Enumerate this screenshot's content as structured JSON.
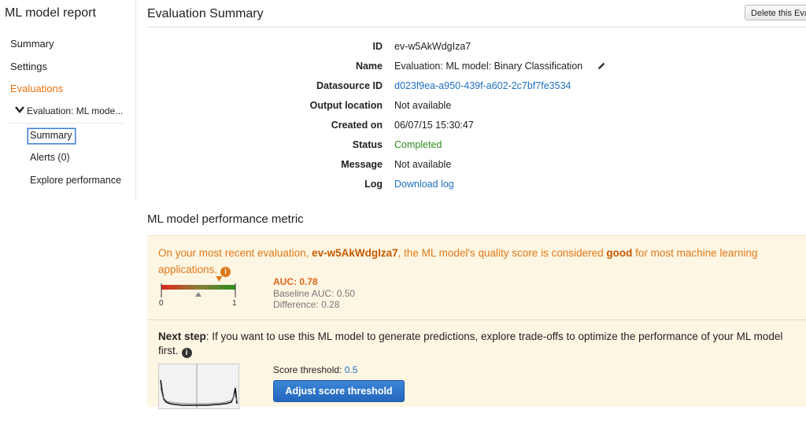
{
  "sidebar": {
    "title": "ML model report",
    "items": [
      {
        "label": "Summary"
      },
      {
        "label": "Settings"
      },
      {
        "label": "Evaluations"
      }
    ],
    "sub_title": "Evaluation: ML mode...",
    "sub_items": [
      {
        "label": "Summary"
      },
      {
        "label": "Alerts (0)"
      },
      {
        "label": "Explore performance"
      }
    ]
  },
  "header": {
    "title": "Evaluation Summary",
    "delete_button": "Delete this Evaluation"
  },
  "details": {
    "id_label": "ID",
    "id_value": "ev-w5AkWdgIza7",
    "name_label": "Name",
    "name_value": "Evaluation: ML model: Binary Classification",
    "datasource_label": "Datasource ID",
    "datasource_value": "d023f9ea-a950-439f-a602-2c7bf7fe3534",
    "output_label": "Output location",
    "output_value": "Not available",
    "created_label": "Created on",
    "created_value": "06/07/15 15:30:47",
    "status_label": "Status",
    "status_value": "Completed",
    "message_label": "Message",
    "message_value": "Not available",
    "log_label": "Log",
    "log_value": "Download log"
  },
  "metric": {
    "section_title": "ML model performance metric",
    "intro_before": "On your most recent evaluation,",
    "eval_id": "ev-w5AkWdgIza7",
    "intro_middle": ", the ML model's quality score is considered",
    "quality": "good",
    "intro_after": "for most machine learning applications.",
    "scale_min": "0",
    "scale_max": "1",
    "auc_value": 0.78,
    "baseline_value": 0.5,
    "auc": "AUC: 0.78",
    "baseline": "Baseline AUC: 0.50",
    "difference": "Difference: 0.28"
  },
  "next_step": {
    "label": "Next step",
    "text": ": If you want to use this ML model to generate predictions, explore trade-offs to optimize the performance of your ML model",
    "text2": "first.",
    "score_label": "Score threshold:",
    "score_value": "0.5",
    "button": "Adjust score threshold"
  },
  "colors": {
    "accent": "#ec7211",
    "link": "#1e6fbf",
    "success": "#2e8b1e",
    "panel_bg": "#fdf6e3",
    "button": "#2467bd"
  }
}
